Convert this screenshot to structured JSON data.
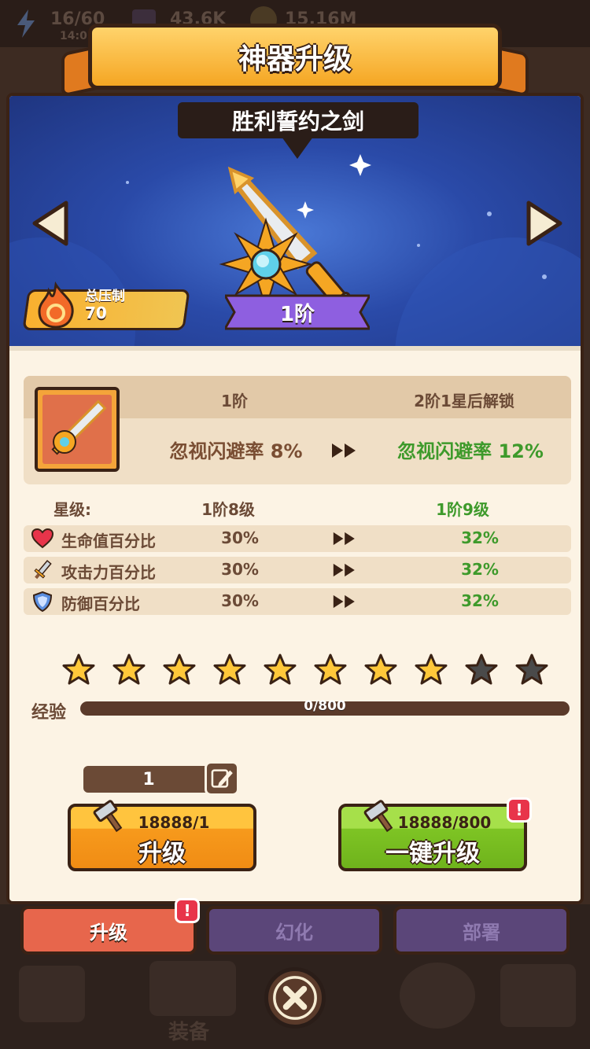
{
  "topbar": {
    "energy": "16/60",
    "energy_timer": "14:0",
    "gems": "43.6K",
    "coins": "15.16M"
  },
  "title": "神器升级",
  "artifact": {
    "name": "胜利誓约之剑",
    "tier": "1阶",
    "suppress_label": "总压制",
    "suppress_value": "70"
  },
  "effect": {
    "current_tier": "1阶",
    "next_tier": "2阶1星后解锁",
    "current_effect": "忽视闪避率 8%",
    "next_effect": "忽视闪避率 12%"
  },
  "stats": {
    "star_label": "星级:",
    "star_current": "1阶8级",
    "star_next": "1阶9级",
    "rows": [
      {
        "icon": "heart-icon",
        "name": "生命值百分比",
        "current": "30%",
        "next": "32%"
      },
      {
        "icon": "sword-icon",
        "name": "攻击力百分比",
        "current": "30%",
        "next": "32%"
      },
      {
        "icon": "shield-icon",
        "name": "防御百分比",
        "current": "30%",
        "next": "32%"
      }
    ]
  },
  "stars": {
    "filled": 8,
    "total": 10
  },
  "exp": {
    "label": "经验",
    "text": "0/800",
    "progress": 0
  },
  "quantity": "1",
  "buttons": {
    "upgrade": {
      "cost": "18888/1",
      "label": "升级"
    },
    "one_click": {
      "cost": "18888/800",
      "label": "一键升级",
      "badge": "!"
    }
  },
  "tabs": [
    {
      "label": "升级",
      "active": true,
      "badge": "!"
    },
    {
      "label": "幻化",
      "active": false
    },
    {
      "label": "部署",
      "active": false
    }
  ],
  "bottom_nav": {
    "equip_label": "装备"
  },
  "colors": {
    "green": "#3e9a2b",
    "brown": "#6b4a36",
    "orange": "#f5a623",
    "purple": "#8e5fe0"
  }
}
